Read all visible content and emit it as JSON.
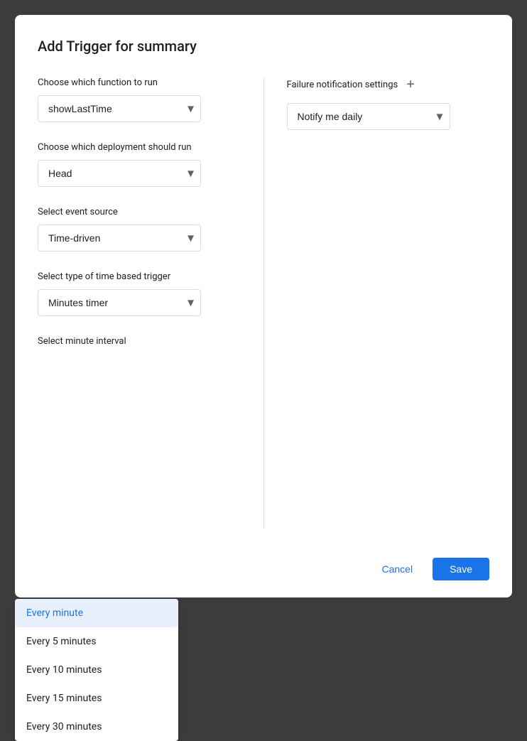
{
  "dialog": {
    "title": "Add Trigger for summary"
  },
  "left": {
    "function_label": "Choose which function to run",
    "function_value": "showLastTime",
    "deployment_label": "Choose which deployment should run",
    "deployment_value": "Head",
    "event_source_label": "Select event source",
    "event_source_value": "Time-driven",
    "trigger_type_label": "Select type of time based trigger",
    "trigger_type_value": "Minutes timer",
    "interval_label": "Select minute interval",
    "interval_options": [
      {
        "label": "Every minute",
        "selected": true
      },
      {
        "label": "Every 5 minutes",
        "selected": false
      },
      {
        "label": "Every 10 minutes",
        "selected": false
      },
      {
        "label": "Every 15 minutes",
        "selected": false
      },
      {
        "label": "Every 30 minutes",
        "selected": false
      }
    ]
  },
  "right": {
    "notification_label": "Failure notification settings",
    "add_icon": "+",
    "notification_value": "Notify me daily"
  },
  "footer": {
    "cancel_label": "Cancel",
    "save_label": "Save"
  },
  "icons": {
    "chevron_down": "▾",
    "plus": "+"
  }
}
